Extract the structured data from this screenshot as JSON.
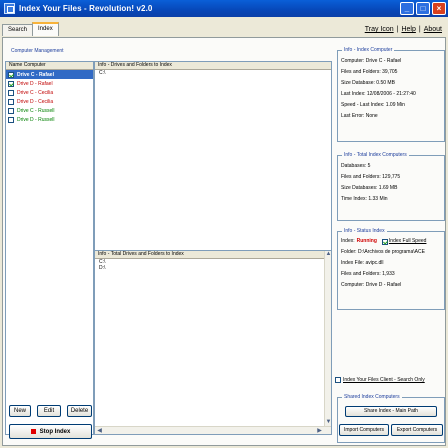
{
  "window": {
    "title": "Index Your Files - Revolution! v2.0"
  },
  "tabs": [
    {
      "label": "Search"
    },
    {
      "label": "Index"
    }
  ],
  "toplinks": {
    "tray": "Tray Icon",
    "help": "Help",
    "about": "About",
    "sep": "|"
  },
  "computer_management": {
    "label": "Computer Management",
    "column": "Name Computer",
    "items": [
      {
        "label": "Drive C - Rafael",
        "checked": true,
        "selected": true
      },
      {
        "label": "Drive D - Rafael",
        "checked": true
      },
      {
        "label": "Drive C - Cecilia",
        "checked": false
      },
      {
        "label": "Drive D - Cecilia",
        "checked": false
      },
      {
        "label": "Drive C - Russell",
        "checked": false
      },
      {
        "label": "Drive D - Russell",
        "checked": false
      }
    ],
    "buttons": {
      "new": "New",
      "edit": "Edit",
      "delete": "Delete",
      "stop": "Stop Index"
    }
  },
  "drives_to_index": {
    "header": "Info - Drives and Folders to Index",
    "items": [
      "C:\\"
    ]
  },
  "total_drives": {
    "header": "Info - Total Drives and Folders to Index",
    "items": [
      "C:\\",
      "D:\\"
    ]
  },
  "info_index_computer": {
    "title": "Info - Index Computer",
    "computer": "Computer: Drive C - Rafael",
    "files_folders": "Files and Folders: 39,705",
    "size_db": "Size Database: 0.50 MB",
    "last_index": "Last Index: 12/08/2006 - 21:27:40",
    "speed": "Speed - Last Index: 1.09 Min",
    "last_error": "Last Error: None"
  },
  "info_total": {
    "title": "Info - Total Index Computers",
    "databases": "Databases: 5",
    "files_folders": "Files and Folders: 129,775",
    "size_db": "Size Databases: 1.69 MB",
    "time_index": "Time Index: 1.33 Min"
  },
  "info_status": {
    "title": "Info - Status Index",
    "index_label": "Index:",
    "index_state": "Running",
    "full_speed": "Index Full Speed",
    "folder": "Folder: D:\\Archivos de programa\\ACE",
    "index_file": "Index File: avipc.dll",
    "files_folders": "Files and Folders: 1,933",
    "computer": "Computer: Drive D - Rafael"
  },
  "client_only": "Index Your Files Client - Search Only",
  "shared": {
    "title": "Shared Index Computers",
    "share_main": "Share Index - Main Path",
    "import": "Import Computers",
    "export": "Export Computers"
  }
}
